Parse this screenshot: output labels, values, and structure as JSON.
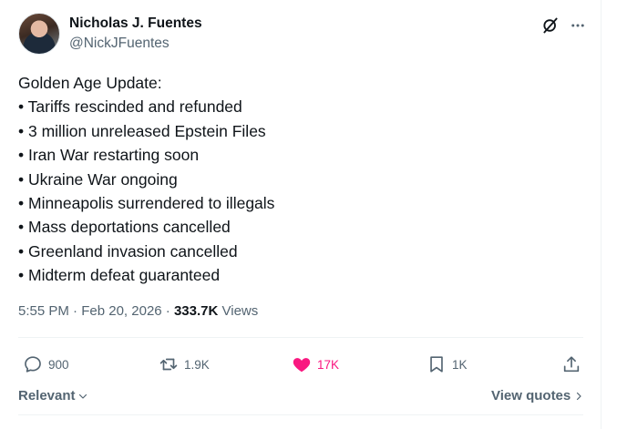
{
  "author": {
    "name": "Nicholas J. Fuentes",
    "handle": "@NickJFuentes"
  },
  "tweet": {
    "lines": [
      "Golden Age Update:",
      "• Tariffs rescinded and refunded",
      "• 3 million unreleased Epstein Files",
      "• Iran War restarting soon",
      "• Ukraine War ongoing",
      "• Minneapolis surrendered to illegals",
      "• Mass deportations cancelled",
      "• Greenland invasion cancelled",
      "• Midterm defeat guaranteed"
    ],
    "time": "5:55 PM",
    "separator": " · ",
    "date": "Feb 20, 2026",
    "views_count": "333.7K",
    "views_label": "Views"
  },
  "actions": {
    "replies": "900",
    "reposts": "1.9K",
    "likes": "17K",
    "bookmarks": "1K"
  },
  "footer": {
    "sort_label": "Relevant",
    "view_quotes": "View quotes"
  },
  "icons": {
    "grok": "grok-icon",
    "more": "more-icon",
    "reply": "reply-icon",
    "retweet": "retweet-icon",
    "like": "heart-icon",
    "bookmark": "bookmark-icon",
    "share": "share-icon"
  },
  "colors": {
    "text_primary": "#0f1419",
    "text_secondary": "#536471",
    "like_active": "#f91880",
    "divider": "#eff3f4"
  }
}
